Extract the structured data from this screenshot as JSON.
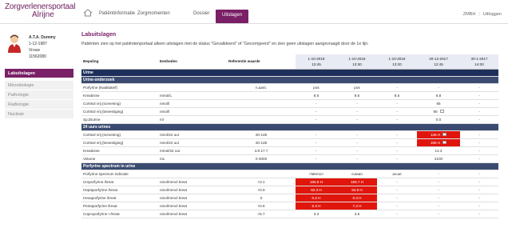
{
  "logo": {
    "line1": "Zorgverlenersportaal",
    "line2": "Alrijne"
  },
  "nav": [
    "Patiëntinformatie",
    "Zorgmomenten",
    "Dossier",
    "Uitslagen"
  ],
  "toplinks": {
    "user": "ZMBH",
    "logout": "Uitloggen"
  },
  "patient": {
    "name": "A.T.A. Dummy",
    "dob": "1-12-1987",
    "gender": "Vrouw",
    "id": "11562080"
  },
  "sidebar": [
    "Labuitslagen",
    "Microbiologie",
    "Pathologie",
    "Radiologie",
    "Nucleair"
  ],
  "page": {
    "title": "Labuitslagen",
    "intro": "Patiënten zien op het patiëntenportaal alleen uitslagen met de status \"Gevalideerd\" of \"Gecorrigeerd\" en zien geen uitslagen aangevraagd door de 1e lijn."
  },
  "table": {
    "headers": [
      "Bepaling",
      "Eenheden",
      "Referentie waarde"
    ],
    "dates": [
      [
        "1-10-2018",
        "13:45"
      ],
      [
        "1-10-2018",
        "13:30"
      ],
      [
        "1-10-2018",
        "13:20"
      ],
      [
        "20-12-2017",
        "12:45"
      ],
      [
        "30-1-2017",
        "14:00"
      ]
    ],
    "rows": [
      {
        "type": "sec1",
        "label": "Urine"
      },
      {
        "type": "sec2",
        "label": "Urine-onderzoek"
      },
      {
        "cells": [
          "Porfyrine (kwalitatief)",
          "",
          "n.aant.",
          "pos",
          "pos",
          "-",
          "-",
          "-"
        ]
      },
      {
        "cells": [
          "Kreatinine",
          "mmol/L",
          "",
          "8.6",
          "8.6",
          "8.6",
          "6.8",
          "-"
        ]
      },
      {
        "cells": [
          "Cortisol vrij (screening)",
          "nmol/l",
          "",
          "-",
          "-",
          "-",
          "65",
          "-"
        ]
      },
      {
        "cells": [
          "Cortisol vrij (bevestiging)",
          "nmol/l",
          "",
          "-",
          "-",
          "-",
          "90",
          "-"
        ],
        "box": 6
      },
      {
        "cells": [
          "Sp.Diurine",
          "ml",
          "",
          "-",
          "-",
          "-",
          "0.0",
          "-"
        ]
      },
      {
        "type": "sec2",
        "label": "24 uurs urines"
      },
      {
        "cells": [
          "Cortisol vrij (screening)",
          "nmol/24 uur",
          "20-135",
          "-",
          "-",
          "-",
          "136 H",
          "-"
        ],
        "red": [
          6
        ]
      },
      {
        "cells": [
          "Cortisol vrij (bevestiging)",
          "nmol/24 uur",
          "20-135",
          "-",
          "-",
          "-",
          "189 H",
          "-"
        ],
        "red": [
          6
        ]
      },
      {
        "cells": [
          "Kreatinine",
          "mmol/24 uur",
          "4.9-17.7",
          "-",
          "-",
          "-",
          "14.3",
          "-"
        ]
      },
      {
        "cells": [
          "Volume",
          "mL",
          "0-3000",
          "-",
          "-",
          "-",
          "2100",
          "-"
        ]
      },
      {
        "type": "sec2",
        "label": "Porfyrine spectrum in urine"
      },
      {
        "cells": [
          "Porfyrine spectrum indicatie",
          "",
          "",
          "<Memo>",
          "cutaan",
          "acuut",
          "-",
          "-"
        ]
      },
      {
        "cells": [
          "Uroporfyrine /kreat",
          "nmol/mmol kreat",
          "<3.1",
          "165.8 H",
          "166.7 H",
          "-",
          "-",
          "-"
        ],
        "red": [
          3,
          4
        ]
      },
      {
        "cells": [
          "Heptaporfyrine /kreat",
          "nmol/mmol kreat",
          "<0.9",
          "82.3 H",
          "94.9 H",
          "-",
          "-",
          "-"
        ],
        "red": [
          3,
          4
        ]
      },
      {
        "cells": [
          "Hexaporfyrine /kreat",
          "nmol/mmol kreat",
          "0",
          "0.2 H",
          "0.3 H",
          "-",
          "-",
          "-"
        ],
        "red": [
          3,
          4
        ]
      },
      {
        "cells": [
          "Pentaporfyrine /kreat",
          "nmol/mmol kreat",
          "<0.6",
          "6.3 H",
          "7.2 H",
          "-",
          "-",
          "-"
        ],
        "red": [
          3,
          4
        ]
      },
      {
        "cells": [
          "Coproporfyrine I /kreat",
          "nmol/mmol kreat",
          "<5.7",
          "3.3",
          "3.6",
          "-",
          "-",
          "-"
        ]
      }
    ]
  },
  "colors": {
    "brand": "#7a2066",
    "section": "#1e2f5b",
    "alert": "#e0160d"
  }
}
